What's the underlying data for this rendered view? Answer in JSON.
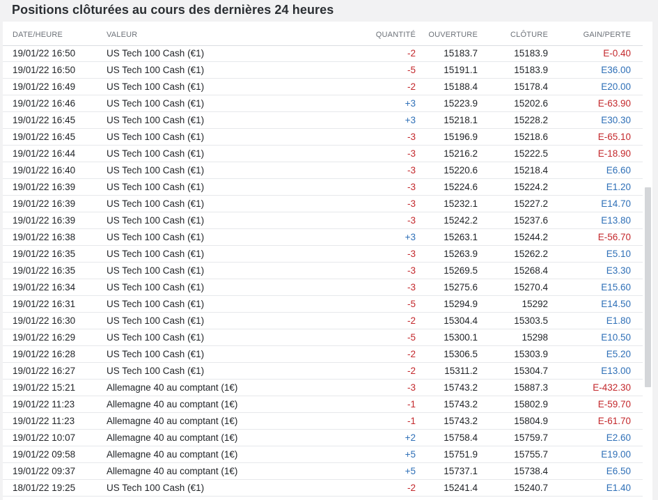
{
  "page_title": "Positions clôturées au cours des dernières 24 heures",
  "columns": {
    "date": "DATE/HEURE",
    "value": "VALEUR",
    "qty": "QUANTITÉ",
    "open": "OUVERTURE",
    "close": "CLÔTURE",
    "pl": "GAIN/PERTE"
  },
  "colors": {
    "negative": "#c3272b",
    "positive": "#2e6fb7"
  },
  "rows": [
    {
      "date": "19/01/22 16:50",
      "value": "US Tech 100 Cash (€1)",
      "qty": "-2",
      "open": "15183.7",
      "close": "15183.9",
      "pl": "E-0.40"
    },
    {
      "date": "19/01/22 16:50",
      "value": "US Tech 100 Cash (€1)",
      "qty": "-5",
      "open": "15191.1",
      "close": "15183.9",
      "pl": "E36.00"
    },
    {
      "date": "19/01/22 16:49",
      "value": "US Tech 100 Cash (€1)",
      "qty": "-2",
      "open": "15188.4",
      "close": "15178.4",
      "pl": "E20.00"
    },
    {
      "date": "19/01/22 16:46",
      "value": "US Tech 100 Cash (€1)",
      "qty": "+3",
      "open": "15223.9",
      "close": "15202.6",
      "pl": "E-63.90"
    },
    {
      "date": "19/01/22 16:45",
      "value": "US Tech 100 Cash (€1)",
      "qty": "+3",
      "open": "15218.1",
      "close": "15228.2",
      "pl": "E30.30"
    },
    {
      "date": "19/01/22 16:45",
      "value": "US Tech 100 Cash (€1)",
      "qty": "-3",
      "open": "15196.9",
      "close": "15218.6",
      "pl": "E-65.10"
    },
    {
      "date": "19/01/22 16:44",
      "value": "US Tech 100 Cash (€1)",
      "qty": "-3",
      "open": "15216.2",
      "close": "15222.5",
      "pl": "E-18.90"
    },
    {
      "date": "19/01/22 16:40",
      "value": "US Tech 100 Cash (€1)",
      "qty": "-3",
      "open": "15220.6",
      "close": "15218.4",
      "pl": "E6.60"
    },
    {
      "date": "19/01/22 16:39",
      "value": "US Tech 100 Cash (€1)",
      "qty": "-3",
      "open": "15224.6",
      "close": "15224.2",
      "pl": "E1.20"
    },
    {
      "date": "19/01/22 16:39",
      "value": "US Tech 100 Cash (€1)",
      "qty": "-3",
      "open": "15232.1",
      "close": "15227.2",
      "pl": "E14.70"
    },
    {
      "date": "19/01/22 16:39",
      "value": "US Tech 100 Cash (€1)",
      "qty": "-3",
      "open": "15242.2",
      "close": "15237.6",
      "pl": "E13.80"
    },
    {
      "date": "19/01/22 16:38",
      "value": "US Tech 100 Cash (€1)",
      "qty": "+3",
      "open": "15263.1",
      "close": "15244.2",
      "pl": "E-56.70"
    },
    {
      "date": "19/01/22 16:35",
      "value": "US Tech 100 Cash (€1)",
      "qty": "-3",
      "open": "15263.9",
      "close": "15262.2",
      "pl": "E5.10"
    },
    {
      "date": "19/01/22 16:35",
      "value": "US Tech 100 Cash (€1)",
      "qty": "-3",
      "open": "15269.5",
      "close": "15268.4",
      "pl": "E3.30"
    },
    {
      "date": "19/01/22 16:34",
      "value": "US Tech 100 Cash (€1)",
      "qty": "-3",
      "open": "15275.6",
      "close": "15270.4",
      "pl": "E15.60"
    },
    {
      "date": "19/01/22 16:31",
      "value": "US Tech 100 Cash (€1)",
      "qty": "-5",
      "open": "15294.9",
      "close": "15292",
      "pl": "E14.50"
    },
    {
      "date": "19/01/22 16:30",
      "value": "US Tech 100 Cash (€1)",
      "qty": "-2",
      "open": "15304.4",
      "close": "15303.5",
      "pl": "E1.80"
    },
    {
      "date": "19/01/22 16:29",
      "value": "US Tech 100 Cash (€1)",
      "qty": "-5",
      "open": "15300.1",
      "close": "15298",
      "pl": "E10.50"
    },
    {
      "date": "19/01/22 16:28",
      "value": "US Tech 100 Cash (€1)",
      "qty": "-2",
      "open": "15306.5",
      "close": "15303.9",
      "pl": "E5.20"
    },
    {
      "date": "19/01/22 16:27",
      "value": "US Tech 100 Cash (€1)",
      "qty": "-2",
      "open": "15311.2",
      "close": "15304.7",
      "pl": "E13.00"
    },
    {
      "date": "19/01/22 15:21",
      "value": "Allemagne 40 au comptant (1€)",
      "qty": "-3",
      "open": "15743.2",
      "close": "15887.3",
      "pl": "E-432.30"
    },
    {
      "date": "19/01/22 11:23",
      "value": "Allemagne 40 au comptant (1€)",
      "qty": "-1",
      "open": "15743.2",
      "close": "15802.9",
      "pl": "E-59.70"
    },
    {
      "date": "19/01/22 11:23",
      "value": "Allemagne 40 au comptant (1€)",
      "qty": "-1",
      "open": "15743.2",
      "close": "15804.9",
      "pl": "E-61.70"
    },
    {
      "date": "19/01/22 10:07",
      "value": "Allemagne 40 au comptant (1€)",
      "qty": "+2",
      "open": "15758.4",
      "close": "15759.7",
      "pl": "E2.60"
    },
    {
      "date": "19/01/22 09:58",
      "value": "Allemagne 40 au comptant (1€)",
      "qty": "+5",
      "open": "15751.9",
      "close": "15755.7",
      "pl": "E19.00"
    },
    {
      "date": "19/01/22 09:37",
      "value": "Allemagne 40 au comptant (1€)",
      "qty": "+5",
      "open": "15737.1",
      "close": "15738.4",
      "pl": "E6.50"
    },
    {
      "date": "18/01/22 19:25",
      "value": "US Tech 100 Cash (€1)",
      "qty": "-2",
      "open": "15241.4",
      "close": "15240.7",
      "pl": "E1.40"
    }
  ]
}
